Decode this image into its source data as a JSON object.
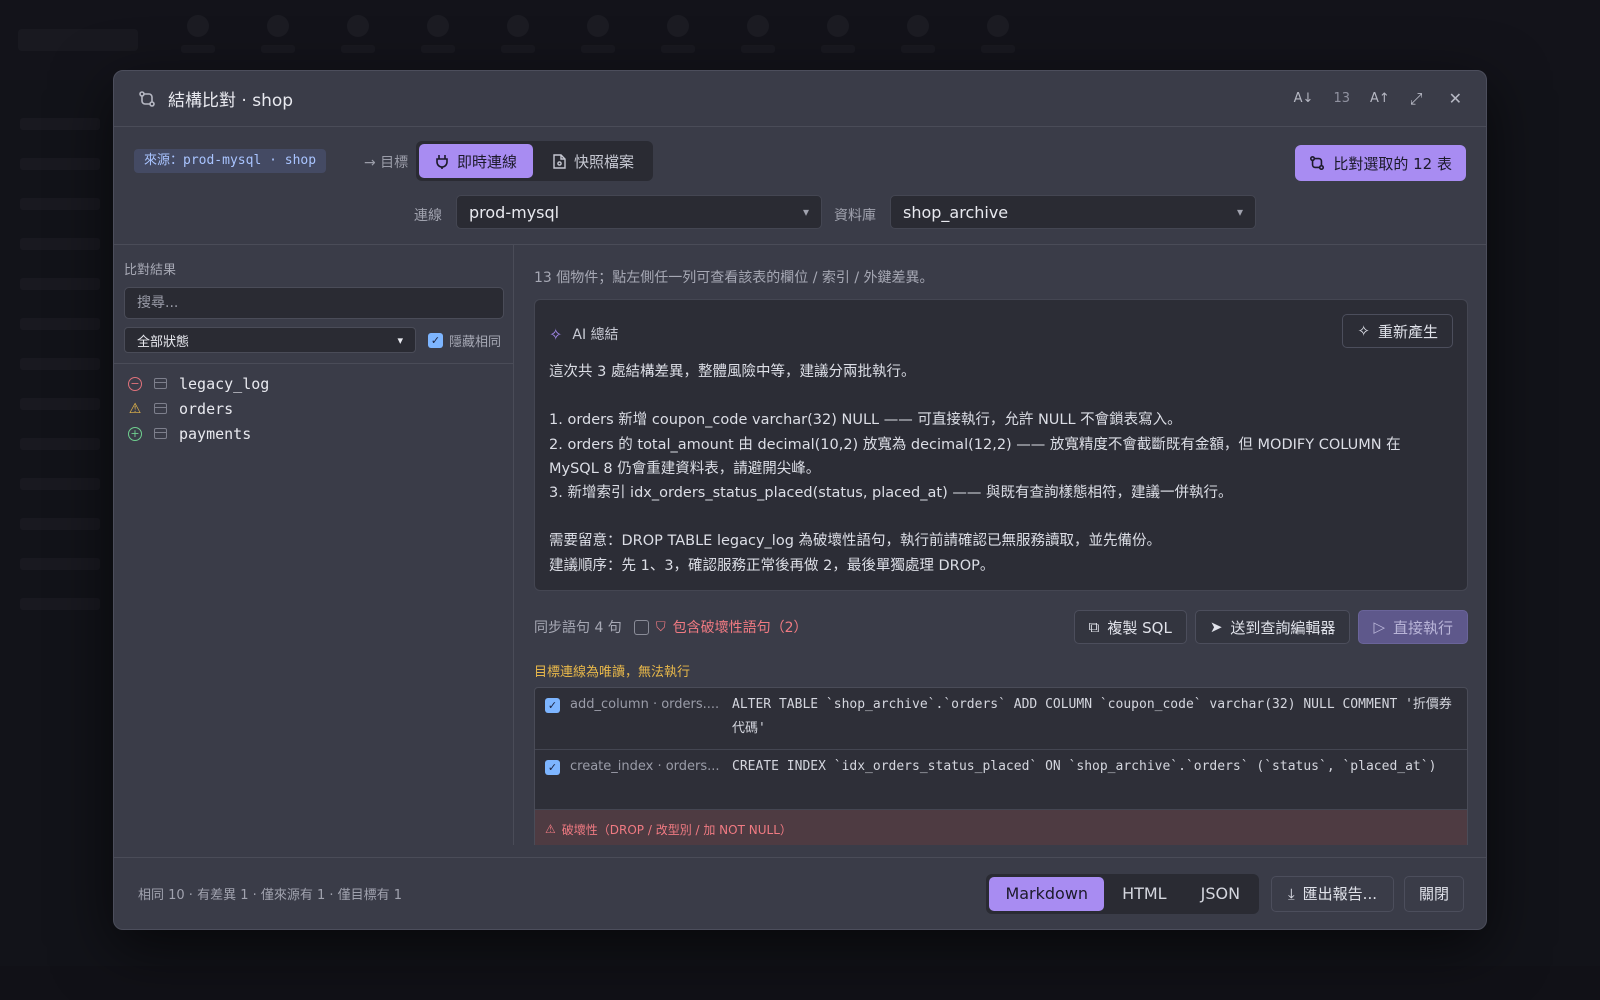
{
  "modal": {
    "title": "結構比對 · shop",
    "font_size": "13",
    "tools": {
      "font_smaller": "A↓",
      "font_larger": "A↑",
      "maximize": "⤢",
      "close": "✕"
    }
  },
  "source": {
    "badge": "來源：prod-mysql · shop",
    "target_label": "→ 目標"
  },
  "mode_tabs": [
    {
      "label": "即時連線",
      "icon": "plug-icon",
      "active": true
    },
    {
      "label": "快照檔案",
      "icon": "file-icon",
      "active": false
    }
  ],
  "compare_button": "比對選取的 12 表",
  "connection": {
    "label": "連線",
    "value": "prod-mysql"
  },
  "database": {
    "label": "資料庫",
    "value": "shop_archive"
  },
  "left": {
    "title": "比對結果",
    "search_placeholder": "搜尋...",
    "status_filter": "全部狀態",
    "hide_same_label": "隱藏相同",
    "hide_same_checked": true,
    "items": [
      {
        "name": "legacy_log",
        "status": "removed"
      },
      {
        "name": "orders",
        "status": "changed"
      },
      {
        "name": "payments",
        "status": "added"
      }
    ]
  },
  "right": {
    "hint": "13 個物件；點左側任一列可查看該表的欄位 / 索引 / 外鍵差異。",
    "ai": {
      "title": "AI 總結",
      "regenerate": "重新產生",
      "text": "這次共 3 處結構差異，整體風險中等，建議分兩批執行。\n\n1. orders 新增 coupon_code varchar(32) NULL —— 可直接執行，允許 NULL 不會鎖表寫入。\n2. orders 的 total_amount 由 decimal(10,2) 放寬為 decimal(12,2) —— 放寬精度不會截斷既有金額，但 MODIFY COLUMN 在 MySQL 8 仍會重建資料表，請避開尖峰。\n3. 新增索引 idx_orders_status_placed(status, placed_at) —— 與既有查詢樣態相符，建議一併執行。\n\n需要留意：DROP TABLE legacy_log 為破壞性語句，執行前請確認已無服務讀取，並先備份。\n建議順序：先 1、3，確認服務正常後再做 2，最後單獨處理 DROP。"
    },
    "sync": {
      "label": "同步語句 4 句",
      "destructive_label": "包含破壞性語句（2）",
      "copy_sql": "複製 SQL",
      "send_editor": "送到查詢編輯器",
      "run": "直接執行"
    },
    "readonly_warning": "目標連線為唯讀，無法執行",
    "statements": [
      {
        "kind": "add_column · orders....",
        "sql": "ALTER TABLE `shop_archive`.`orders` ADD COLUMN `coupon_code` varchar(32) NULL COMMENT '折價券代碼'",
        "checked": true
      },
      {
        "kind": "create_index · orders...",
        "sql": "CREATE INDEX `idx_orders_status_placed` ON `shop_archive`.`orders` (`status`, `placed_at`)",
        "checked": true
      }
    ],
    "destructive_band": "破壞性（DROP / 改型別 / 加 NOT NULL）"
  },
  "footer": {
    "stats": "相同 10 · 有差異 1 · 僅來源有 1 · 僅目標有 1",
    "formats": [
      {
        "label": "Markdown",
        "active": true
      },
      {
        "label": "HTML",
        "active": false
      },
      {
        "label": "JSON",
        "active": false
      }
    ],
    "export": "匯出報告...",
    "close": "關閉"
  },
  "colors": {
    "accent": "#a88cf2",
    "danger": "#f07a82",
    "warning": "#e8b84a",
    "added": "#6fcf8f",
    "link": "#a9c4ff"
  }
}
